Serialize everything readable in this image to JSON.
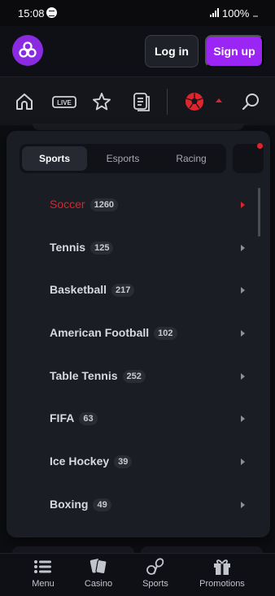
{
  "status_bar": {
    "time": "15:08",
    "battery": "100%"
  },
  "header": {
    "login_label": "Log in",
    "signup_label": "Sign up"
  },
  "nav": {
    "items": [
      "home-icon",
      "live-icon",
      "star-icon",
      "betslip-icon",
      "soccer-ball-icon",
      "search-icon"
    ],
    "live_label": "LIVE"
  },
  "tabs": [
    {
      "label": "Sports",
      "active": true
    },
    {
      "label": "Esports",
      "active": false
    },
    {
      "label": "Racing",
      "active": false
    }
  ],
  "sports": [
    {
      "name": "Soccer",
      "count": "1260",
      "active": true
    },
    {
      "name": "Tennis",
      "count": "125"
    },
    {
      "name": "Basketball",
      "count": "217"
    },
    {
      "name": "American Football",
      "count": "102"
    },
    {
      "name": "Table Tennis",
      "count": "252"
    },
    {
      "name": "FIFA",
      "count": "63"
    },
    {
      "name": "Ice Hockey",
      "count": "39"
    },
    {
      "name": "Boxing",
      "count": "49"
    }
  ],
  "bottom_nav": [
    {
      "label": "Menu",
      "icon": "menu-icon"
    },
    {
      "label": "Casino",
      "icon": "cards-icon"
    },
    {
      "label": "Sports",
      "icon": "sports-icon"
    },
    {
      "label": "Promotions",
      "icon": "gift-icon"
    }
  ],
  "colors": {
    "accent": "#9b25f5",
    "active": "#d8262c",
    "panel": "#1b1d24",
    "background": "#0d0e12"
  }
}
